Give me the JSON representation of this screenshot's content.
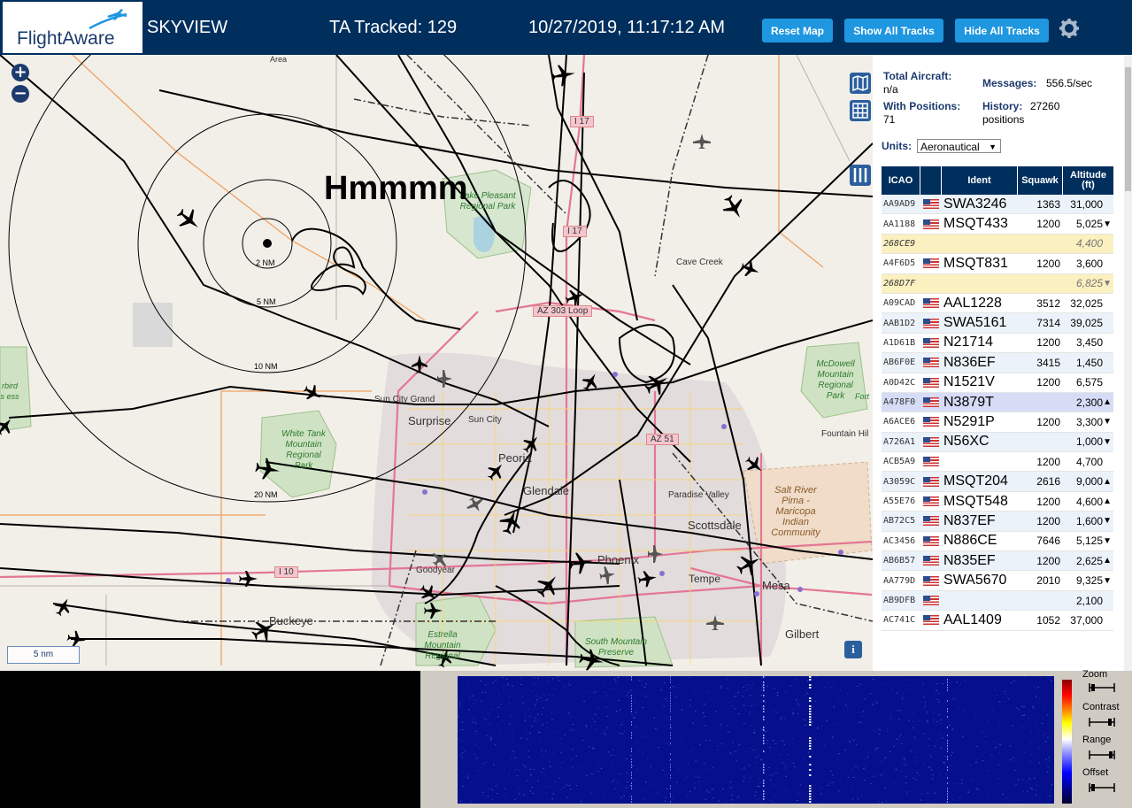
{
  "header": {
    "logo_text": "FlightAware",
    "app_title": "SKYVIEW",
    "tracked": "TA Tracked: 129",
    "datetime": "10/27/2019, 11:17:12 AM",
    "buttons": {
      "reset_map": "Reset Map",
      "show_all": "Show All Tracks",
      "hide_all": "Hide All Tracks"
    },
    "colors": {
      "bar": "#002f5d",
      "button": "#1e96e0"
    }
  },
  "map": {
    "annotation": "Hmmmm",
    "rings": [
      "2 NM",
      "5 NM",
      "10 NM",
      "20 NM"
    ],
    "scale": "5 nm",
    "places": [
      "Area",
      "Lake Pleasant Regional Park",
      "Cave Creek",
      "Sun City Grand",
      "Surprise",
      "Sun City",
      "Peoria",
      "Glendale",
      "Paradise Valley",
      "Scottsdale",
      "Phoenix",
      "Tempe",
      "Mesa",
      "Goodyear",
      "Buckeye",
      "Gilbert",
      "Fountain Hil",
      "White Tank Mountain Regional Park",
      "McDowell Mountain Regional Park",
      "Salt River Pima - Maricopa Indian Community",
      "Estrella Mountain Regional",
      "South Mountain Preserve",
      "Fort",
      "rbird s ess"
    ],
    "roads": [
      "I 17",
      "I 17",
      "AZ 303 Loop",
      "AZ 51",
      "I 10"
    ]
  },
  "panel": {
    "total_aircraft_label": "Total Aircraft:",
    "total_aircraft_value": "n/a",
    "with_positions_label": "With Positions:",
    "with_positions_value": "71",
    "messages_label": "Messages:",
    "messages_value": "556.5/sec",
    "history_label": "History:",
    "history_value": "27260",
    "history_unit": "positions",
    "units_label": "Units:",
    "units_value": "Aeronautical",
    "columns": [
      "ICAO",
      "",
      "Ident",
      "Squawk",
      "Altitude (ft)"
    ],
    "rows": [
      {
        "icao": "AA9AD9",
        "ident": "SWA3246",
        "squawk": "1363",
        "alt": "31,000",
        "trend": "",
        "type": "even"
      },
      {
        "icao": "AA1188",
        "ident": "MSQT433",
        "squawk": "1200",
        "alt": "5,025",
        "trend": "▼",
        "type": "odd"
      },
      {
        "icao": "268CE9",
        "ident": "",
        "squawk": "",
        "alt": "4,400",
        "trend": "",
        "type": "mlat"
      },
      {
        "icao": "A4F6D5",
        "ident": "MSQT831",
        "squawk": "1200",
        "alt": "3,600",
        "trend": "",
        "type": "odd"
      },
      {
        "icao": "268D7F",
        "ident": "",
        "squawk": "",
        "alt": "6,825",
        "trend": "▼",
        "type": "mlat"
      },
      {
        "icao": "A09CAD",
        "ident": "AAL1228",
        "squawk": "3512",
        "alt": "32,025",
        "trend": "",
        "type": "odd"
      },
      {
        "icao": "AAB1D2",
        "ident": "SWA5161",
        "squawk": "7314",
        "alt": "39,025",
        "trend": "",
        "type": "even"
      },
      {
        "icao": "A1D61B",
        "ident": "N21714",
        "squawk": "1200",
        "alt": "3,450",
        "trend": "",
        "type": "odd"
      },
      {
        "icao": "AB6F0E",
        "ident": "N836EF",
        "squawk": "3415",
        "alt": "1,450",
        "trend": "",
        "type": "even"
      },
      {
        "icao": "A0D42C",
        "ident": "N1521V",
        "squawk": "1200",
        "alt": "6,575",
        "trend": "",
        "type": "odd"
      },
      {
        "icao": "A478F0",
        "ident": "N3879T",
        "squawk": "",
        "alt": "2,300",
        "trend": "▲",
        "type": "sel"
      },
      {
        "icao": "A6ACE6",
        "ident": "N5291P",
        "squawk": "1200",
        "alt": "3,300",
        "trend": "▼",
        "type": "odd"
      },
      {
        "icao": "A726A1",
        "ident": "N56XC",
        "squawk": "",
        "alt": "1,000",
        "trend": "▼",
        "type": "even"
      },
      {
        "icao": "ACB5A9",
        "ident": "",
        "squawk": "1200",
        "alt": "4,700",
        "trend": "",
        "type": "odd"
      },
      {
        "icao": "A3059C",
        "ident": "MSQT204",
        "squawk": "2616",
        "alt": "9,000",
        "trend": "▲",
        "type": "even"
      },
      {
        "icao": "A55E76",
        "ident": "MSQT548",
        "squawk": "1200",
        "alt": "4,600",
        "trend": "▲",
        "type": "odd"
      },
      {
        "icao": "AB72C5",
        "ident": "N837EF",
        "squawk": "1200",
        "alt": "1,600",
        "trend": "▼",
        "type": "even"
      },
      {
        "icao": "AC3456",
        "ident": "N886CE",
        "squawk": "7646",
        "alt": "5,125",
        "trend": "▼",
        "type": "odd"
      },
      {
        "icao": "AB6B57",
        "ident": "N835EF",
        "squawk": "1200",
        "alt": "2,625",
        "trend": "▲",
        "type": "even"
      },
      {
        "icao": "AA779D",
        "ident": "SWA5670",
        "squawk": "2010",
        "alt": "9,325",
        "trend": "▼",
        "type": "odd"
      },
      {
        "icao": "AB9DFB",
        "ident": "",
        "squawk": "",
        "alt": "2,100",
        "trend": "",
        "type": "even"
      },
      {
        "icao": "AC741C",
        "ident": "AAL1409",
        "squawk": "1052",
        "alt": "37,000",
        "trend": "",
        "type": "odd"
      }
    ]
  },
  "waterfall": {
    "controls": [
      "Zoom",
      "Contrast",
      "Range",
      "Offset"
    ]
  }
}
